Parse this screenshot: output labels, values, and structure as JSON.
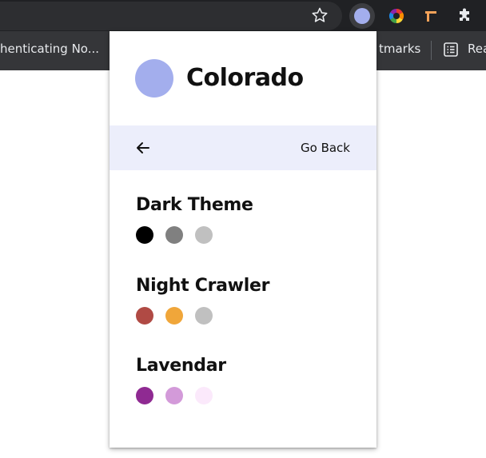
{
  "browser": {
    "bookmarks": {
      "left_item_label": "henticating No...",
      "right_item_label": "tmarks",
      "reading_list_label": "Rea"
    },
    "extension_dot_color": "#a3aeed"
  },
  "popup": {
    "title": "Colorado",
    "logo_color": "#a3aeed",
    "nav": {
      "go_back_label": "Go Back"
    },
    "themes": [
      {
        "name": "Dark Theme",
        "colors": [
          "#000000",
          "#808080",
          "#c0c0c0"
        ]
      },
      {
        "name": "Night Crawler",
        "colors": [
          "#b04a44",
          "#f0a63a",
          "#c0c0c0"
        ]
      },
      {
        "name": "Lavendar",
        "colors": [
          "#8f2a92",
          "#d39ad9",
          "#fbe9fb"
        ]
      }
    ]
  }
}
